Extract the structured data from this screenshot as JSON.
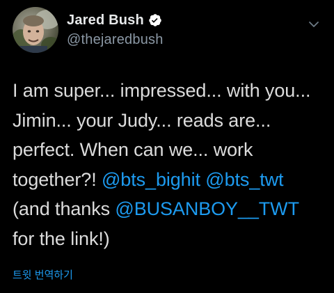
{
  "user": {
    "display_name": "Jared Bush",
    "handle": "@thejaredbush",
    "verified": true,
    "avatar_icon": "profile-photo"
  },
  "tweet": {
    "line1": "I am super... impressed... with you...",
    "line2": "Jimin... your Judy... reads are...",
    "line3": "perfect. When can we... work",
    "line4_text": "together?! ",
    "mention1": "@bts_bighit",
    "line4_space": " ",
    "mention2": "@bts_twt",
    "line5_text": "(and thanks ",
    "mention3": "@BUSANBOY__TWT",
    "line6": "for the link!)"
  },
  "translate_label": "트윗 번역하기",
  "colors": {
    "background": "#000000",
    "text": "#dcdcdc",
    "link": "#1d9bf0",
    "secondary": "#8b98a5",
    "verified_badge": "#ffffff"
  }
}
